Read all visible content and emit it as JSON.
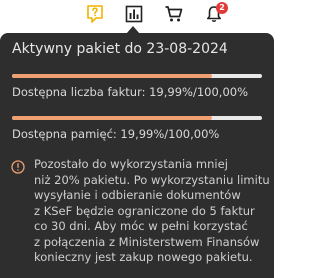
{
  "header": {
    "icons": [
      "question-icon",
      "chart-icon",
      "cart-icon",
      "bell-icon"
    ],
    "notification_count": "2",
    "accent_color": "#f0b400"
  },
  "popup": {
    "title": "Aktywny pakiet do 23-08-2024",
    "invoices_label": "Dostępna liczba faktur: 19,99%/100,00%",
    "invoices_progress_percent": 19.99,
    "memory_label": "Dostępna pamięć: 19,99%/100,00%",
    "memory_progress_percent": 19.99,
    "info_lines": [
      "Pozostało do wykorzystania mniej",
      "niż 20% pakietu. Po wykorzystaniu limitu",
      "wysyłanie i odbieranie dokumentów",
      "z KSeF będzie ograniczone do 5 faktur",
      "co 30 dni. Aby móc w pełni korzystać",
      "z połączenia z Ministerstwem Finansów",
      "konieczny  jest zakup nowego pakietu."
    ],
    "progress_color": "#f0a070",
    "info_icon_color": "#f0a070"
  }
}
